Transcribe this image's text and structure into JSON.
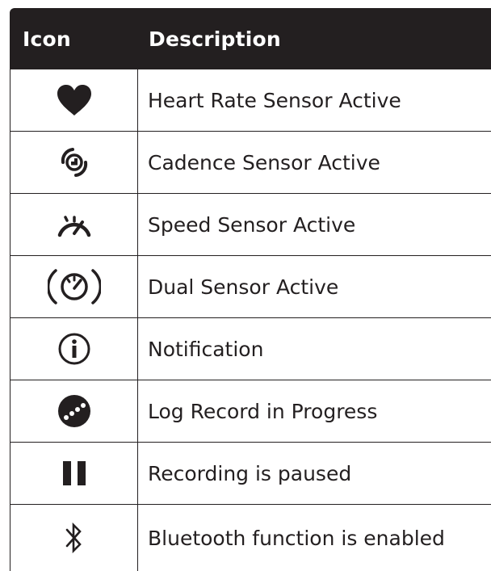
{
  "header": {
    "icon_label": "Icon",
    "description_label": "Description"
  },
  "rows": [
    {
      "icon": "heart-icon",
      "description": "Heart Rate Sensor Active"
    },
    {
      "icon": "cadence-sensor-icon",
      "description": "Cadence Sensor Active"
    },
    {
      "icon": "speed-sensor-icon",
      "description": "Speed Sensor Active"
    },
    {
      "icon": "dual-sensor-icon",
      "description": "Dual Sensor Active"
    },
    {
      "icon": "info-icon",
      "description": "Notification"
    },
    {
      "icon": "log-record-icon",
      "description": "Log Record in Progress"
    },
    {
      "icon": "pause-icon",
      "description": "Recording is paused"
    },
    {
      "icon": "bluetooth-icon",
      "description": "Bluetooth function is enabled"
    }
  ],
  "colors": {
    "header_background": "#231f20",
    "header_text": "#ffffff",
    "border": "#231f20",
    "text": "#231f20"
  }
}
